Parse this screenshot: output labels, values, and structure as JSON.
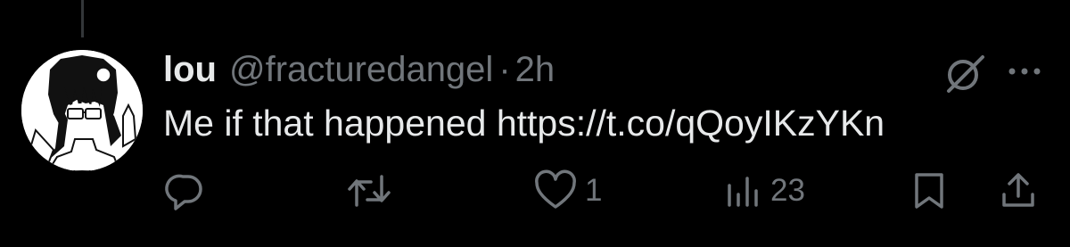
{
  "tweet": {
    "display_name": "lou",
    "handle": "@fracturedangel",
    "separator": "·",
    "time": "2h",
    "text": "Me if that happened https://t.co/qQoyIKzYKn"
  },
  "actions": {
    "reply": {
      "icon": "reply-icon",
      "count": ""
    },
    "retweet": {
      "icon": "retweet-icon",
      "count": ""
    },
    "like": {
      "icon": "heart-icon",
      "count": "1"
    },
    "views": {
      "icon": "views-icon",
      "count": "23"
    },
    "bookmark": {
      "icon": "bookmark-icon"
    },
    "share": {
      "icon": "share-icon"
    }
  },
  "header_icons": {
    "grok": "grok-icon",
    "more": "more-icon"
  },
  "colors": {
    "background": "#000000",
    "primary_text": "#e7e9ea",
    "secondary_text": "#71767b",
    "thread_line": "#333639"
  }
}
